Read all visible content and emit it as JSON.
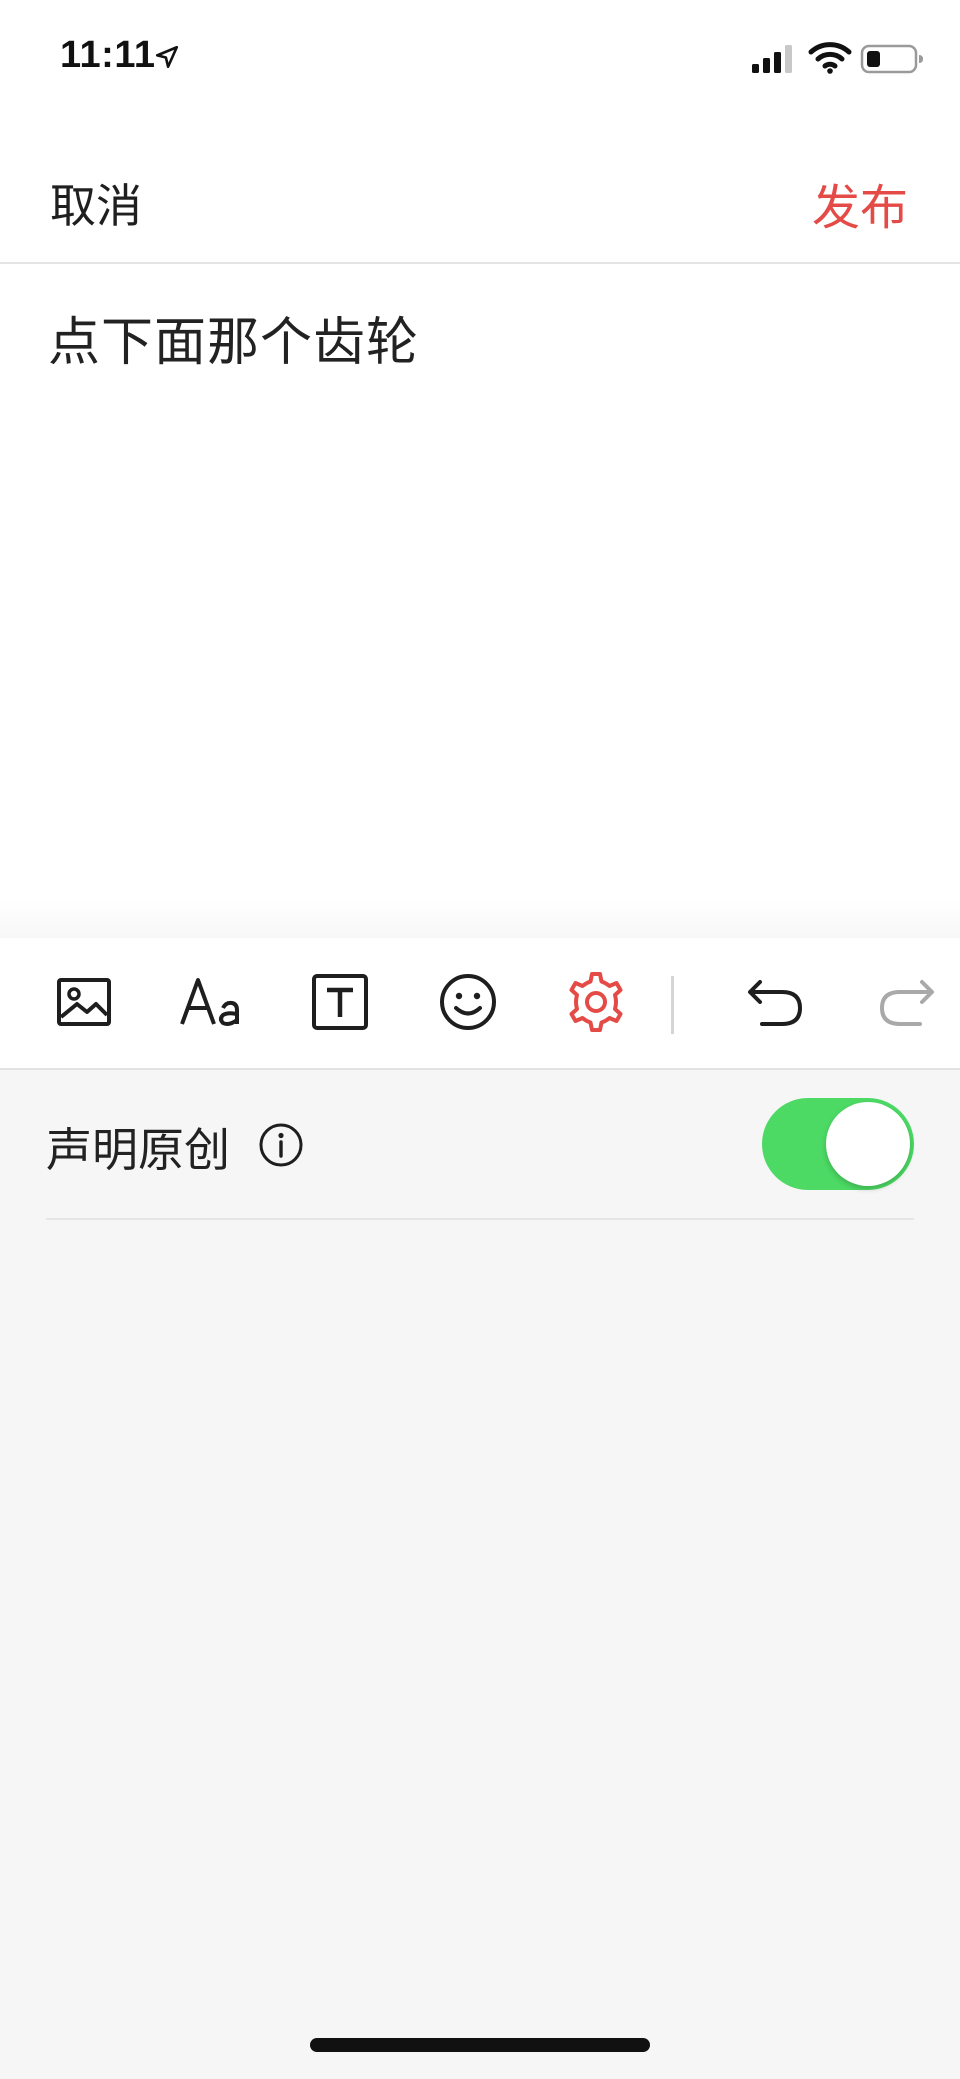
{
  "status_bar": {
    "time": "11:11",
    "location_icon": "location-arrow-icon",
    "signal_icon": "cellular-signal-icon",
    "wifi_icon": "wifi-icon",
    "battery_icon": "battery-icon"
  },
  "nav": {
    "cancel_label": "取消",
    "publish_label": "发布",
    "publish_color": "#e44b46"
  },
  "editor": {
    "text": "点下面那个齿轮"
  },
  "toolbar": {
    "tools": [
      {
        "name": "image-icon"
      },
      {
        "name": "font-style-icon",
        "label": "Aa"
      },
      {
        "name": "text-box-icon",
        "label": "T"
      },
      {
        "name": "emoji-icon"
      },
      {
        "name": "settings-gear-icon",
        "active": true,
        "color": "#e44b46"
      },
      {
        "name": "undo-icon"
      },
      {
        "name": "redo-icon",
        "disabled": true
      }
    ]
  },
  "settings": {
    "original_declaration": {
      "label": "声明原创",
      "info_icon": "info-icon",
      "enabled": true,
      "toggle_color": "#4cd964"
    }
  }
}
